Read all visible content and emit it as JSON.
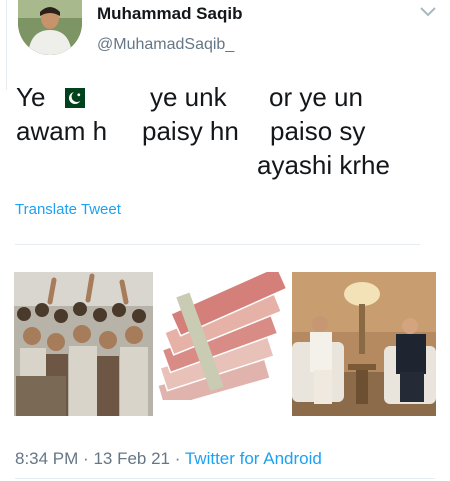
{
  "user": {
    "name": "Muhammad Saqib",
    "handle": "@MuhamadSaqib_"
  },
  "tweet": {
    "segments": [
      "Ye",
      "ye unk",
      "or ye un",
      "awam h",
      "paisy hn",
      "paiso sy",
      "ayashi krhe"
    ],
    "emoji": "pakistan-flag-icon",
    "translate_label": "Translate Tweet"
  },
  "meta": {
    "time": "8:34 PM",
    "sep1": "·",
    "date": "13 Feb 21",
    "sep2": "·",
    "source": "Twitter for Android"
  },
  "media": {
    "panels": [
      "crowd-photo",
      "banknotes-photo",
      "meeting-photo"
    ]
  },
  "colors": {
    "link": "#1da1f2",
    "secondary_text": "#657786",
    "flag_green": "#01411c"
  }
}
